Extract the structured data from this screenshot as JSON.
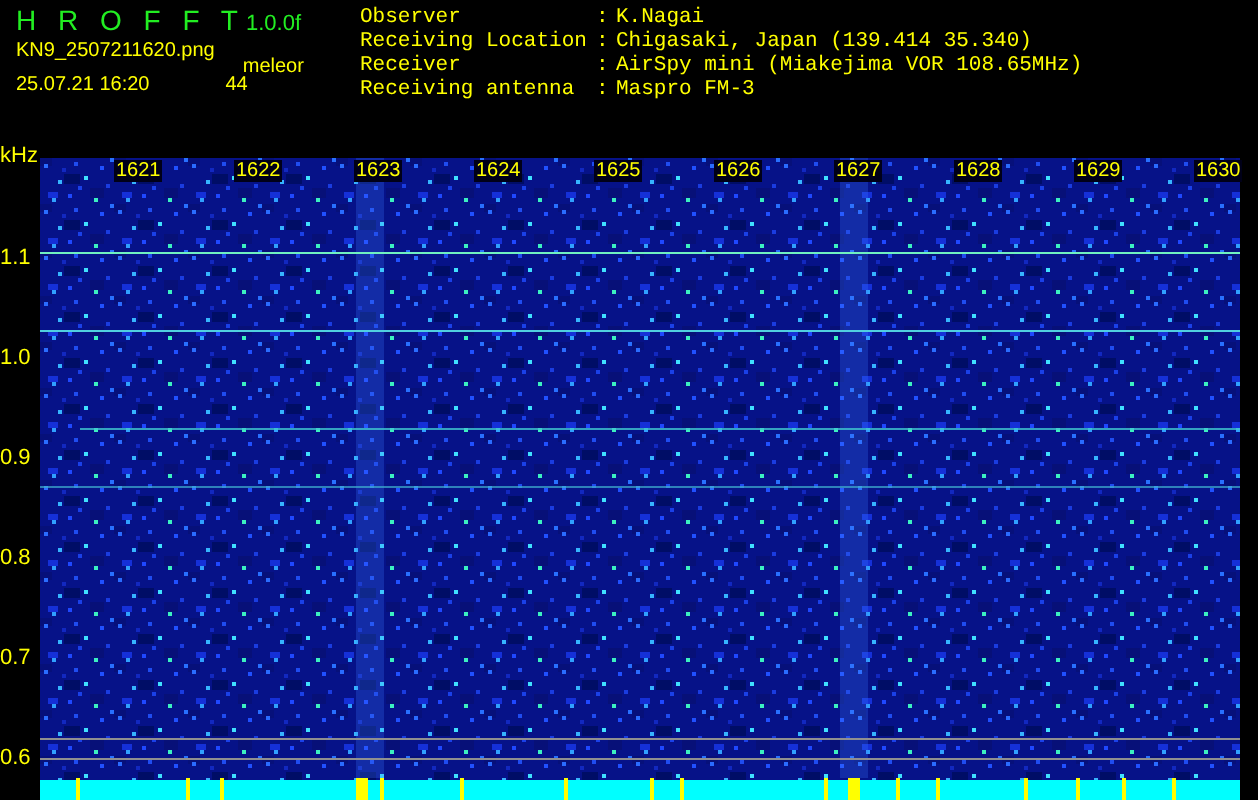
{
  "app": {
    "title": "H R O F F T",
    "version": "1.0.0f",
    "file": "KN9_2507211620.png",
    "mode": "meleor",
    "timestamp": "25.07.21 16:20",
    "count": "44"
  },
  "station_info": [
    {
      "label": "Observer",
      "separator": ":",
      "value": "K.Nagai"
    },
    {
      "label": "Receiving Location",
      "separator": ":",
      "value": "Chigasaki, Japan (139.414 35.340)"
    },
    {
      "label": "Receiver",
      "separator": ":",
      "value": "AirSpy mini (Miakejima VOR 108.65MHz)"
    },
    {
      "label": "Receiving antenna",
      "separator": ":",
      "value": "Maspro FM-3"
    }
  ],
  "spectrogram": {
    "unit": "kHz",
    "frequency_labels": [
      "1621",
      "1622",
      "1623",
      "1624",
      "1625",
      "1626",
      "1627",
      "1628",
      "1629",
      "1630"
    ],
    "y_labels": [
      "1.1",
      "1.0",
      "0.9",
      "0.8",
      "0.7",
      "0.6"
    ]
  }
}
